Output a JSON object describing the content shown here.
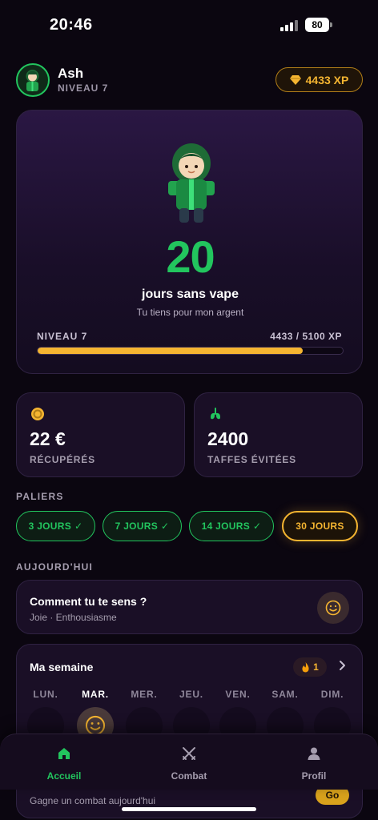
{
  "status": {
    "time": "20:46",
    "battery": "80"
  },
  "user": {
    "name": "Ash",
    "level": "NIVEAU 7",
    "xp": "4433 XP"
  },
  "hero": {
    "days": "20",
    "days_label": "jours sans vape",
    "subtitle": "Tu tiens pour mon argent",
    "level_label": "NIVEAU 7",
    "xp_progress": "4433 / 5100 XP",
    "progress_fraction": 0.869
  },
  "stats": [
    {
      "value": "22 €",
      "label": "RÉCUPÉRÉS",
      "icon": "coin-icon"
    },
    {
      "value": "2400",
      "label": "TAFFES ÉVITÉES",
      "icon": "lungs-icon"
    }
  ],
  "milestones": {
    "title": "PALIERS",
    "items": [
      {
        "label": "3 JOURS",
        "check": "✓",
        "state": "done"
      },
      {
        "label": "7 JOURS",
        "check": "✓",
        "state": "done"
      },
      {
        "label": "14 JOURS",
        "check": "✓",
        "state": "done"
      },
      {
        "label": "30 JOURS",
        "check": "",
        "state": "current"
      }
    ]
  },
  "today": {
    "title": "AUJOURD'HUI",
    "feeling_title": "Comment tu te sens ?",
    "feeling_sub": "Joie · Enthousiasme"
  },
  "week": {
    "title": "Ma semaine",
    "streak": "1",
    "days": [
      "LUN.",
      "MAR.",
      "MER.",
      "JEU.",
      "VEN.",
      "SAM.",
      "DIM."
    ],
    "active_day": 1
  },
  "combat": {
    "subtitle": "Gagne un combat aujourd'hui",
    "go": "Go"
  },
  "nav": [
    {
      "label": "Accueil",
      "icon": "home-icon",
      "active": true
    },
    {
      "label": "Combat",
      "icon": "swords-icon",
      "active": false
    },
    {
      "label": "Profil",
      "icon": "person-icon",
      "active": false
    }
  ],
  "colors": {
    "accent_green": "#22c55e",
    "accent_gold": "#f5b531",
    "background": "#0b0610"
  }
}
